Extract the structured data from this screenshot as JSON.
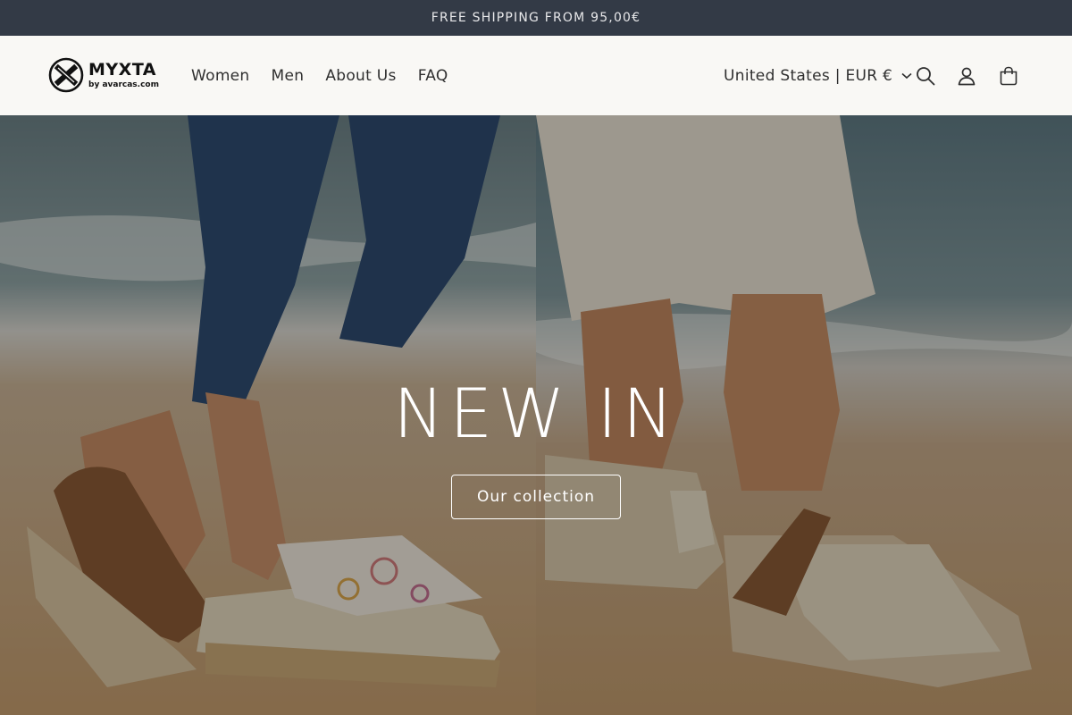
{
  "announcement": {
    "text": "FREE SHIPPING FROM 95,00€"
  },
  "logo": {
    "name": "MYXTA",
    "subtitle": "by avarcas.com"
  },
  "nav": {
    "items": [
      {
        "label": "Women"
      },
      {
        "label": "Men"
      },
      {
        "label": "About Us"
      },
      {
        "label": "FAQ"
      }
    ]
  },
  "region": {
    "label": "United States | EUR €"
  },
  "icons": {
    "search": "search-icon",
    "account": "account-icon",
    "cart": "cart-icon",
    "chevron": "chevron-down-icon"
  },
  "hero": {
    "title": "NEW IN",
    "button_label": "Our collection"
  },
  "colors": {
    "announcement_bg": "#333a46",
    "header_bg": "#f9f8f5"
  }
}
